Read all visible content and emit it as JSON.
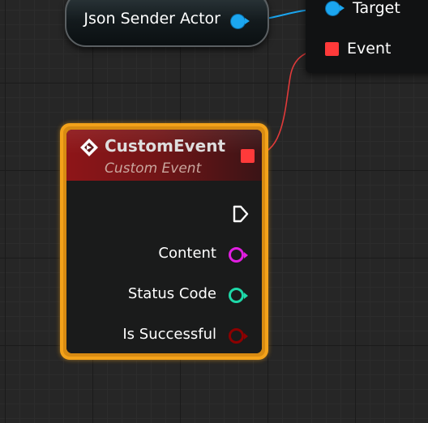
{
  "graph": {
    "variable_node": {
      "label": "Json Sender Actor",
      "pin_color": "#1ba6f0"
    },
    "function_node": {
      "pins": [
        {
          "label": "Target",
          "type": "object",
          "color": "#1ba6f0"
        },
        {
          "label": "Event",
          "type": "delegate",
          "color": "#ff3a3a"
        }
      ]
    },
    "custom_event_node": {
      "title": "CustomEvent",
      "subtitle": "Custom Event",
      "icon": "event-diamond-icon",
      "header_color": "#8e1518",
      "border_color": "#f3a21a",
      "delegate_pin_color": "#ff3a3a",
      "outputs": [
        {
          "label": "Content",
          "type": "string",
          "color": "#e11ee1"
        },
        {
          "label": "Status Code",
          "type": "integer",
          "color": "#1ed8a8"
        },
        {
          "label": "Is Successful",
          "type": "boolean",
          "color": "#8c0000"
        }
      ]
    },
    "wires": [
      {
        "from": "Json Sender Actor",
        "to": "Target",
        "color": "#1ba6f0"
      },
      {
        "from": "CustomEvent",
        "to": "Event",
        "color": "#e03a3a"
      }
    ]
  }
}
